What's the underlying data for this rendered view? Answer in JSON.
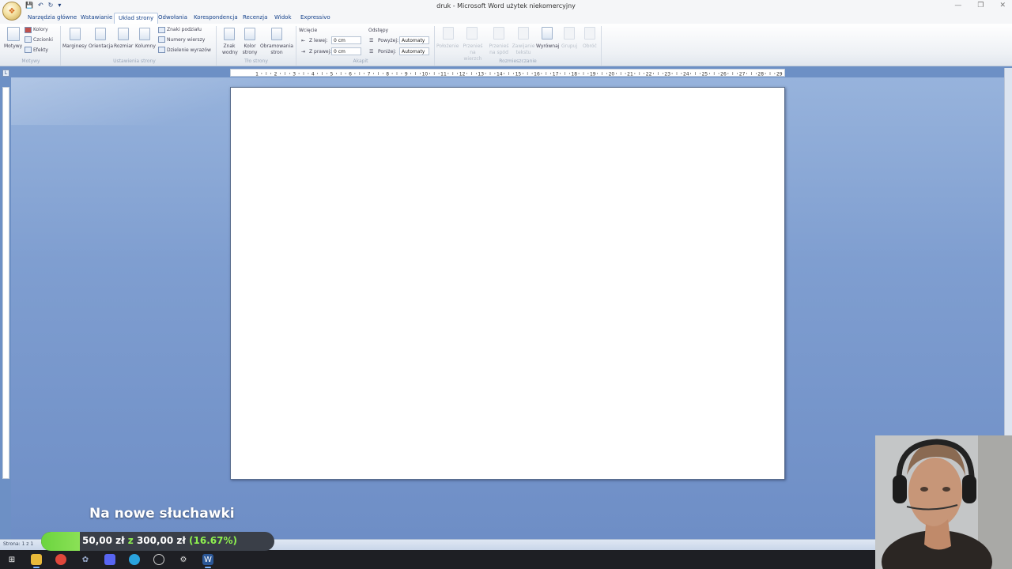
{
  "window": {
    "title": "druk - Microsoft Word użytek niekomercyjny",
    "controls": [
      "—",
      "❐",
      "✕"
    ]
  },
  "quick_access": {
    "icons": [
      "save-icon",
      "undo-icon",
      "redo-icon",
      "customize-icon"
    ]
  },
  "tabs": [
    {
      "label": "Narzędzia główne",
      "active": false
    },
    {
      "label": "Wstawianie",
      "active": false
    },
    {
      "label": "Układ strony",
      "active": true
    },
    {
      "label": "Odwołania",
      "active": false
    },
    {
      "label": "Korespondencja",
      "active": false
    },
    {
      "label": "Recenzja",
      "active": false
    },
    {
      "label": "Widok",
      "active": false
    },
    {
      "label": "Expressivo",
      "active": false
    }
  ],
  "ribbon": {
    "motywy": {
      "group_label": "Motywy",
      "main_label": "Motywy",
      "items": [
        "Kolory",
        "Czcionki",
        "Efekty"
      ]
    },
    "ustawienia": {
      "group_label": "Ustawienia strony",
      "buttons": [
        "Marginesy",
        "Orientacja",
        "Rozmiar",
        "Kolumny"
      ],
      "side_items": [
        "Znaki podziału",
        "Numery wierszy",
        "Dzielenie wyrazów"
      ]
    },
    "tlo": {
      "group_label": "Tło strony",
      "buttons": [
        "Znak wodny",
        "Kolor strony",
        "Obramowania stron"
      ]
    },
    "akapit": {
      "group_label": "Akapit",
      "wciecie_label": "Wcięcie",
      "z_lewej_label": "Z lewej:",
      "z_lewej_value": "0 cm",
      "z_prawej_label": "Z prawej:",
      "z_prawej_value": "0 cm",
      "odstepy_label": "Odstępy",
      "powyzej_label": "Powyżej:",
      "powyzej_value": "Automaty",
      "ponizej_label": "Poniżej:",
      "ponizej_value": "Automaty"
    },
    "rozmieszczanie": {
      "group_label": "Rozmieszczanie",
      "buttons": [
        {
          "label": "Położenie",
          "enabled": false
        },
        {
          "label": "Przenieś na wierzch",
          "enabled": false
        },
        {
          "label": "Przenieś na spód",
          "enabled": false
        },
        {
          "label": "Zawijanie tekstu",
          "enabled": false
        },
        {
          "label": "Wyrównaj",
          "enabled": true
        },
        {
          "label": "Grupuj",
          "enabled": false
        },
        {
          "label": "Obróć",
          "enabled": false
        }
      ]
    }
  },
  "ruler": {
    "ticks": [
      "1",
      "2",
      "3",
      "4",
      "5",
      "6",
      "7",
      "8",
      "9",
      "10",
      "11",
      "12",
      "13",
      "14",
      "15",
      "16",
      "17",
      "18",
      "19",
      "20",
      "21",
      "22",
      "23",
      "24",
      "25",
      "26",
      "27",
      "28",
      "29"
    ]
  },
  "status": {
    "text": "Strona: 1 z 1"
  },
  "donation": {
    "title": "Na nowe słuchawki",
    "current": "50,00 zł",
    "separator": "z",
    "goal": "300,00 zł",
    "percent": "(16.67%)",
    "progress": 0.1667
  },
  "taskbar": {
    "icons": [
      "start-icon",
      "file-explorer-icon",
      "browser-icon",
      "app-icon",
      "discord-icon",
      "telegram-icon",
      "obs-icon",
      "settings-icon",
      "word-icon"
    ]
  },
  "colors": {
    "accent_green": "#8ef04f",
    "workspace_blue": "#7f9ed0",
    "tab_text": "#15428b"
  }
}
